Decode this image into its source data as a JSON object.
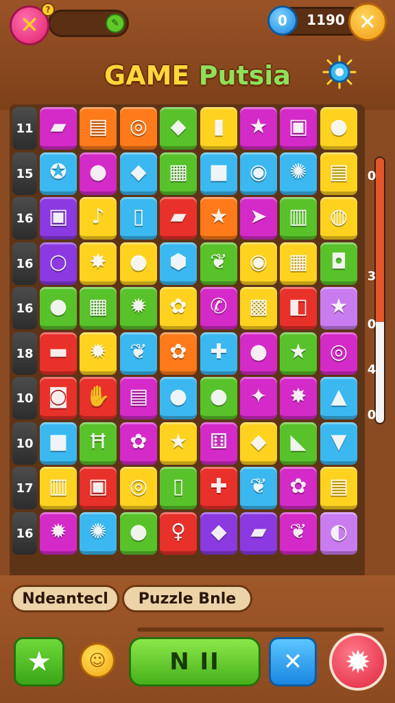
{
  "header": {
    "help_badge": "?",
    "score": "1190",
    "title_part1": "GAME",
    "title_part2": "Putsia"
  },
  "colors": {
    "magenta": "#d42ac8",
    "orange": "#ff7a1a",
    "red": "#e8312a",
    "green": "#58c22a",
    "yellow": "#ffd21f",
    "blue": "#3bb8f0",
    "purple": "#8a3ae0",
    "lavender": "#c97cf0"
  },
  "board": {
    "rows": [
      {
        "label": "11",
        "tiles": [
          {
            "color": "magenta",
            "icon": "green-book-icon",
            "glyph": "▰"
          },
          {
            "color": "orange",
            "icon": "scroll-icon",
            "glyph": "▤"
          },
          {
            "color": "orange",
            "icon": "target-icon",
            "glyph": "◎"
          },
          {
            "color": "green",
            "icon": "cat-face-icon",
            "glyph": "◆"
          },
          {
            "color": "yellow",
            "icon": "red-capsule-icon",
            "glyph": "▮"
          },
          {
            "color": "magenta",
            "icon": "star-icon",
            "glyph": "★"
          },
          {
            "color": "magenta",
            "icon": "frame-icon",
            "glyph": "▣"
          },
          {
            "color": "yellow",
            "icon": "bird-icon",
            "glyph": "●"
          }
        ]
      },
      {
        "label": "15",
        "tiles": [
          {
            "color": "blue",
            "icon": "gear-icon",
            "glyph": "✪"
          },
          {
            "color": "magenta",
            "icon": "fruit-icon",
            "glyph": "●"
          },
          {
            "color": "blue",
            "icon": "red-gem-icon",
            "glyph": "◆"
          },
          {
            "color": "green",
            "icon": "crate-icon",
            "glyph": "▦"
          },
          {
            "color": "blue",
            "icon": "red-block-icon",
            "glyph": "■"
          },
          {
            "color": "blue",
            "icon": "coin-icon",
            "glyph": "◉"
          },
          {
            "color": "blue",
            "icon": "cog-icon",
            "glyph": "✺"
          },
          {
            "color": "yellow",
            "icon": "sandwich-icon",
            "glyph": "▤"
          }
        ]
      },
      {
        "label": "16",
        "tiles": [
          {
            "color": "purple",
            "icon": "box-icon",
            "glyph": "▣"
          },
          {
            "color": "yellow",
            "icon": "music-note-icon",
            "glyph": "♪"
          },
          {
            "color": "blue",
            "icon": "bottle-icon",
            "glyph": "▯"
          },
          {
            "color": "red",
            "icon": "phone-icon",
            "glyph": "▰"
          },
          {
            "color": "orange",
            "icon": "star-icon",
            "glyph": "★"
          },
          {
            "color": "magenta",
            "icon": "arrow-icon",
            "glyph": "➤"
          },
          {
            "color": "green",
            "icon": "lantern-icon",
            "glyph": "▥"
          },
          {
            "color": "yellow",
            "icon": "drum-icon",
            "glyph": "◍"
          }
        ]
      },
      {
        "label": "16",
        "tiles": [
          {
            "color": "purple",
            "icon": "ring-icon",
            "glyph": "○"
          },
          {
            "color": "yellow",
            "icon": "paint-splat-icon",
            "glyph": "✸"
          },
          {
            "color": "yellow",
            "icon": "robot-car-icon",
            "glyph": "●"
          },
          {
            "color": "blue",
            "icon": "hexagon-icon",
            "glyph": "⬢"
          },
          {
            "color": "green",
            "icon": "leaf-icon",
            "glyph": "❦"
          },
          {
            "color": "yellow",
            "icon": "bubble-icon",
            "glyph": "◉"
          },
          {
            "color": "yellow",
            "icon": "card-icon",
            "glyph": "▦"
          },
          {
            "color": "green",
            "icon": "cylinder-icon",
            "glyph": "◘"
          }
        ]
      },
      {
        "label": "16",
        "tiles": [
          {
            "color": "green",
            "icon": "onion-icon",
            "glyph": "●"
          },
          {
            "color": "green",
            "icon": "cube-icon",
            "glyph": "▦"
          },
          {
            "color": "green",
            "icon": "gear-icon",
            "glyph": "✹"
          },
          {
            "color": "yellow",
            "icon": "flower-icon",
            "glyph": "✿"
          },
          {
            "color": "magenta",
            "icon": "phone-icon",
            "glyph": "✆"
          },
          {
            "color": "yellow",
            "icon": "window-icon",
            "glyph": "▩"
          },
          {
            "color": "red",
            "icon": "letter-c-icon",
            "glyph": "◧"
          },
          {
            "color": "lavender",
            "icon": "star-icon",
            "glyph": "★"
          }
        ]
      },
      {
        "label": "18",
        "tiles": [
          {
            "color": "red",
            "icon": "chest-icon",
            "glyph": "▬"
          },
          {
            "color": "yellow",
            "icon": "flame-icon",
            "glyph": "✹"
          },
          {
            "color": "blue",
            "icon": "leaf-icon",
            "glyph": "❦"
          },
          {
            "color": "orange",
            "icon": "flower-icon",
            "glyph": "✿"
          },
          {
            "color": "blue",
            "icon": "cross-icon",
            "glyph": "✚"
          },
          {
            "color": "magenta",
            "icon": "turtle-icon",
            "glyph": "●"
          },
          {
            "color": "green",
            "icon": "star-icon",
            "glyph": "★"
          },
          {
            "color": "magenta",
            "icon": "magnifier-icon",
            "glyph": "◎"
          }
        ]
      },
      {
        "label": "10",
        "tiles": [
          {
            "color": "red",
            "icon": "hat-icon",
            "glyph": "◙"
          },
          {
            "color": "red",
            "icon": "hand-icon",
            "glyph": "✋"
          },
          {
            "color": "magenta",
            "icon": "book-icon",
            "glyph": "▤"
          },
          {
            "color": "blue",
            "icon": "orb-icon",
            "glyph": "●"
          },
          {
            "color": "green",
            "icon": "frog-icon",
            "glyph": "●"
          },
          {
            "color": "magenta",
            "icon": "sparkle-icon",
            "glyph": "✦"
          },
          {
            "color": "magenta",
            "icon": "splash-icon",
            "glyph": "✸"
          },
          {
            "color": "blue",
            "icon": "bell-icon",
            "glyph": "▲"
          }
        ]
      },
      {
        "label": "10",
        "tiles": [
          {
            "color": "blue",
            "icon": "cube-icon",
            "glyph": "■"
          },
          {
            "color": "green",
            "icon": "letter-h-icon",
            "glyph": "Ħ"
          },
          {
            "color": "magenta",
            "icon": "flower-icon",
            "glyph": "✿"
          },
          {
            "color": "yellow",
            "icon": "star-icon",
            "glyph": "★"
          },
          {
            "color": "magenta",
            "icon": "dice-icon",
            "glyph": "⚅"
          },
          {
            "color": "yellow",
            "icon": "lips-icon",
            "glyph": "◆"
          },
          {
            "color": "green",
            "icon": "cheese-icon",
            "glyph": "◣"
          },
          {
            "color": "blue",
            "icon": "basket-icon",
            "glyph": "▼"
          }
        ]
      },
      {
        "label": "17",
        "tiles": [
          {
            "color": "yellow",
            "icon": "cabinet-icon",
            "glyph": "▥"
          },
          {
            "color": "red",
            "icon": "radio-icon",
            "glyph": "▣"
          },
          {
            "color": "yellow",
            "icon": "magnifier-icon",
            "glyph": "◎"
          },
          {
            "color": "green",
            "icon": "can-icon",
            "glyph": "▯"
          },
          {
            "color": "red",
            "icon": "puzzle-piece-icon",
            "glyph": "✚"
          },
          {
            "color": "blue",
            "icon": "leaf-icon",
            "glyph": "❦"
          },
          {
            "color": "magenta",
            "icon": "flower-icon",
            "glyph": "✿"
          },
          {
            "color": "yellow",
            "icon": "scroll-icon",
            "glyph": "▤"
          }
        ]
      },
      {
        "label": "16",
        "tiles": [
          {
            "color": "magenta",
            "icon": "sun-gear-icon",
            "glyph": "✹"
          },
          {
            "color": "blue",
            "icon": "cog-icon",
            "glyph": "✺"
          },
          {
            "color": "green",
            "icon": "bell-icon",
            "glyph": "●"
          },
          {
            "color": "red",
            "icon": "lollipop-icon",
            "glyph": "♀"
          },
          {
            "color": "purple",
            "icon": "box-icon",
            "glyph": "◆"
          },
          {
            "color": "purple",
            "icon": "green-bar-icon",
            "glyph": "▰"
          },
          {
            "color": "magenta",
            "icon": "shell-icon",
            "glyph": "❦"
          },
          {
            "color": "lavender",
            "icon": "moon-icon",
            "glyph": "◐"
          }
        ]
      }
    ]
  },
  "side_meter": {
    "fill_fraction": 0.62,
    "numbers": [
      "0",
      "3",
      "0",
      "4",
      "0"
    ]
  },
  "footer": {
    "mode_left": "Ndeantecl",
    "mode_right": "Puzzle Bnle",
    "play_label": "N II"
  }
}
